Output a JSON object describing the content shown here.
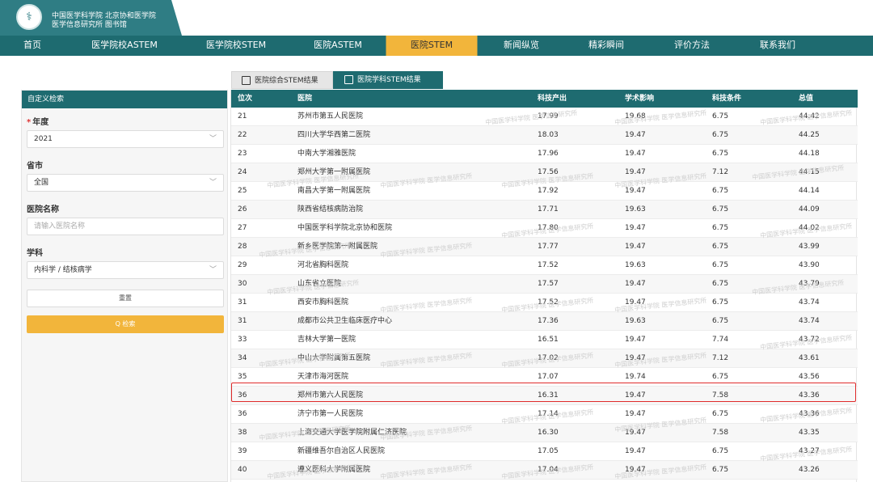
{
  "header": {
    "logo_glyph": "⚕",
    "org_line1": "中国医学科学院 北京协和医学院",
    "org_line2": "医学信息研究所  图书馆"
  },
  "nav": {
    "items": [
      {
        "label": "首页"
      },
      {
        "label": "医学院校ASTEM"
      },
      {
        "label": "医学院校STEM"
      },
      {
        "label": "医院ASTEM"
      },
      {
        "label": "医院STEM",
        "active": true
      },
      {
        "label": "新闻纵览"
      },
      {
        "label": "精彩瞬间"
      },
      {
        "label": "评价方法"
      },
      {
        "label": "联系我们"
      }
    ]
  },
  "tabs": {
    "comprehensive": "医院综合STEM结果",
    "discipline": "医院学科STEM结果"
  },
  "filter": {
    "title": "自定义检索",
    "year_label": "年度",
    "year_value": "2021",
    "province_label": "省市",
    "province_value": "全国",
    "hospital_label": "医院名称",
    "hospital_placeholder": "请输入医院名称",
    "subject_label": "学科",
    "subject_value": "内科学 / 结核病学",
    "reset_label": "重置",
    "search_label": "Q 检索"
  },
  "table": {
    "columns": [
      "位次",
      "医院",
      "科技产出",
      "学术影响",
      "科技条件",
      "总值"
    ],
    "rows": [
      [
        "21",
        "苏州市第五人民医院",
        "17.99",
        "19.68",
        "6.75",
        "44.42"
      ],
      [
        "22",
        "四川大学华西第二医院",
        "18.03",
        "19.47",
        "6.75",
        "44.25"
      ],
      [
        "23",
        "中南大学湘雅医院",
        "17.96",
        "19.47",
        "6.75",
        "44.18"
      ],
      [
        "24",
        "郑州大学第一附属医院",
        "17.56",
        "19.47",
        "7.12",
        "44.15"
      ],
      [
        "25",
        "南昌大学第一附属医院",
        "17.92",
        "19.47",
        "6.75",
        "44.14"
      ],
      [
        "26",
        "陕西省结核病防治院",
        "17.71",
        "19.63",
        "6.75",
        "44.09"
      ],
      [
        "27",
        "中国医学科学院北京协和医院",
        "17.80",
        "19.47",
        "6.75",
        "44.02"
      ],
      [
        "28",
        "新乡医学院第一附属医院",
        "17.77",
        "19.47",
        "6.75",
        "43.99"
      ],
      [
        "29",
        "河北省胸科医院",
        "17.52",
        "19.63",
        "6.75",
        "43.90"
      ],
      [
        "30",
        "山东省立医院",
        "17.57",
        "19.47",
        "6.75",
        "43.79"
      ],
      [
        "31",
        "西安市胸科医院",
        "17.52",
        "19.47",
        "6.75",
        "43.74"
      ],
      [
        "31",
        "成都市公共卫生临床医疗中心",
        "17.36",
        "19.63",
        "6.75",
        "43.74"
      ],
      [
        "33",
        "吉林大学第一医院",
        "16.51",
        "19.47",
        "7.74",
        "43.72"
      ],
      [
        "34",
        "中山大学附属第五医院",
        "17.02",
        "19.47",
        "7.12",
        "43.61"
      ],
      [
        "35",
        "天津市海河医院",
        "17.07",
        "19.74",
        "6.75",
        "43.56"
      ],
      [
        "36",
        "郑州市第六人民医院",
        "16.31",
        "19.47",
        "7.58",
        "43.36"
      ],
      [
        "36",
        "济宁市第一人民医院",
        "17.14",
        "19.47",
        "6.75",
        "43.36"
      ],
      [
        "38",
        "上海交通大学医学院附属仁济医院",
        "16.30",
        "19.47",
        "7.58",
        "43.35"
      ],
      [
        "39",
        "新疆维吾尔自治区人民医院",
        "17.05",
        "19.47",
        "6.75",
        "43.27"
      ],
      [
        "40",
        "遵义医科大学附属医院",
        "17.04",
        "19.47",
        "6.75",
        "43.26"
      ]
    ]
  },
  "watermark": "中国医学科学院 医学信息研究所",
  "colors": {
    "primary": "#1e6b70",
    "accent": "#f2b53b",
    "highlight_border": "#e02b2b"
  }
}
